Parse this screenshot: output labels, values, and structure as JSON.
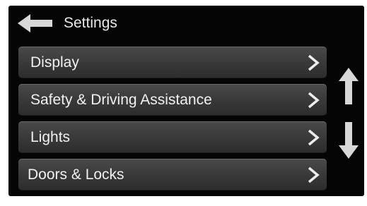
{
  "header": {
    "title": "Settings",
    "back_icon": "arrow-left-icon"
  },
  "menu": {
    "items": [
      {
        "label": "Display",
        "icon": "chevron-right-icon"
      },
      {
        "label": "Safety & Driving Assistance",
        "icon": "chevron-right-icon"
      },
      {
        "label": "Lights",
        "icon": "chevron-right-icon"
      },
      {
        "label": "Doors & Locks",
        "icon": "chevron-right-icon"
      }
    ]
  },
  "scroll": {
    "up_icon": "arrow-up-icon",
    "down_icon": "arrow-down-icon"
  },
  "colors": {
    "screen_background": "#050505",
    "item_background": "#3b3b3b",
    "text": "#f0f0f0",
    "icon": "#d8d8d8"
  }
}
